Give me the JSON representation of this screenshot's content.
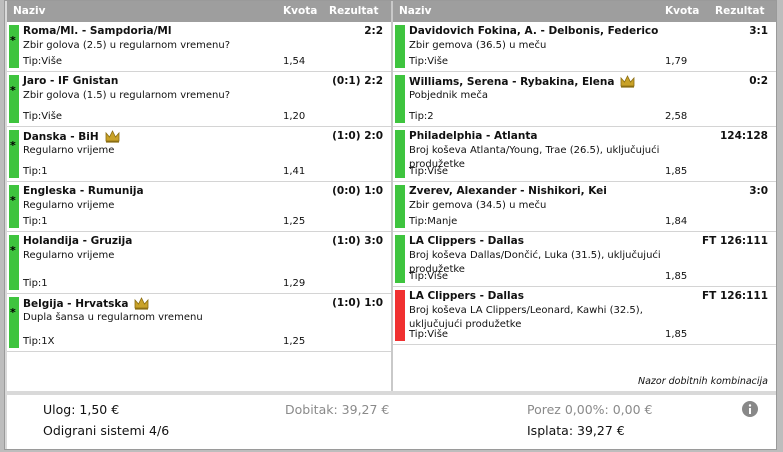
{
  "header": {
    "naziv": "Naziv",
    "kvota": "Kvota",
    "rezultat": "Rezultat"
  },
  "colors": {
    "win": "#3ec43e",
    "loss": "#f03030",
    "header": "#9e9e9e",
    "crown": "#c9a227"
  },
  "left": [
    {
      "status": "win",
      "star": "*",
      "match": "Roma/Ml. - Sampdoria/Ml",
      "crown": false,
      "market": "Zbir golova (2.5) u regularnom vremenu?",
      "tip": "Tip:Više",
      "odd": "1,54",
      "result": "2:2"
    },
    {
      "status": "win",
      "star": "*",
      "match": "Jaro - IF Gnistan",
      "crown": false,
      "market": "Zbir golova (1.5) u regularnom vremenu?",
      "tip": "Tip:Više",
      "odd": "1,20",
      "result": "(0:1) 2:2"
    },
    {
      "status": "win",
      "star": "*",
      "match": "Danska - BiH",
      "crown": true,
      "market": "Regularno vrijeme",
      "tip": "Tip:1",
      "odd": "1,41",
      "result": "(1:0) 2:0"
    },
    {
      "status": "win",
      "star": "*",
      "match": "Engleska - Rumunija",
      "crown": false,
      "market": "Regularno vrijeme",
      "tip": "Tip:1",
      "odd": "1,25",
      "result": "(0:0) 1:0"
    },
    {
      "status": "win",
      "star": "*",
      "match": "Holandija - Gruzija",
      "crown": false,
      "market": "Regularno vrijeme",
      "tip": "Tip:1",
      "odd": "1,29",
      "result": "(1:0) 3:0"
    },
    {
      "status": "win",
      "star": "*",
      "match": "Belgija - Hrvatska",
      "crown": true,
      "market": "Dupla šansa u regularnom vremenu",
      "tip": "Tip:1X",
      "odd": "1,25",
      "result": "(1:0) 1:0"
    }
  ],
  "right": [
    {
      "status": "win",
      "match": "Davidovich Fokina, A. - Delbonis, Federico",
      "crown": false,
      "market": "Zbir gemova (36.5) u meču",
      "tip": "Tip:Više",
      "odd": "1,79",
      "result": "3:1"
    },
    {
      "status": "win",
      "match": "Williams, Serena - Rybakina, Elena",
      "crown": true,
      "market": "Pobjednik meča",
      "tip": "Tip:2",
      "odd": "2,58",
      "result": "0:2"
    },
    {
      "status": "win",
      "match": "Philadelphia - Atlanta",
      "crown": false,
      "market": "Broj koševa Atlanta/Young, Trae (26.5), uključujući produžetke",
      "tip": "Tip:Više",
      "odd": "1,85",
      "result": "124:128"
    },
    {
      "status": "win",
      "match": "Zverev, Alexander - Nishikori, Kei",
      "crown": false,
      "market": "Zbir gemova (34.5) u meču",
      "tip": "Tip:Manje",
      "odd": "1,84",
      "result": "3:0"
    },
    {
      "status": "win",
      "match": "LA Clippers - Dallas",
      "crown": false,
      "market": "Broj koševa Dallas/Dončić, Luka (31.5), uključujući produžetke",
      "tip": "Tip:Više",
      "odd": "1,85",
      "result": "FT  126:111"
    },
    {
      "status": "loss",
      "match": "LA Clippers - Dallas",
      "crown": false,
      "market": "Broj koševa LA Clippers/Leonard, Kawhi (32.5), uključujući produžetke",
      "tip": "Tip:Više",
      "odd": "1,85",
      "result": "FT  126:111"
    }
  ],
  "footnote": "Nazor dobitnih kombinacija",
  "summary": {
    "ulog": "Ulog: 1,50 €",
    "odigrani": "Odigrani sistemi 4/6",
    "dobitak": "Dobitak: 39,27 €",
    "porez": "Porez 0,00%: 0,00 €",
    "isplata": "Isplata: 39,27 €"
  }
}
